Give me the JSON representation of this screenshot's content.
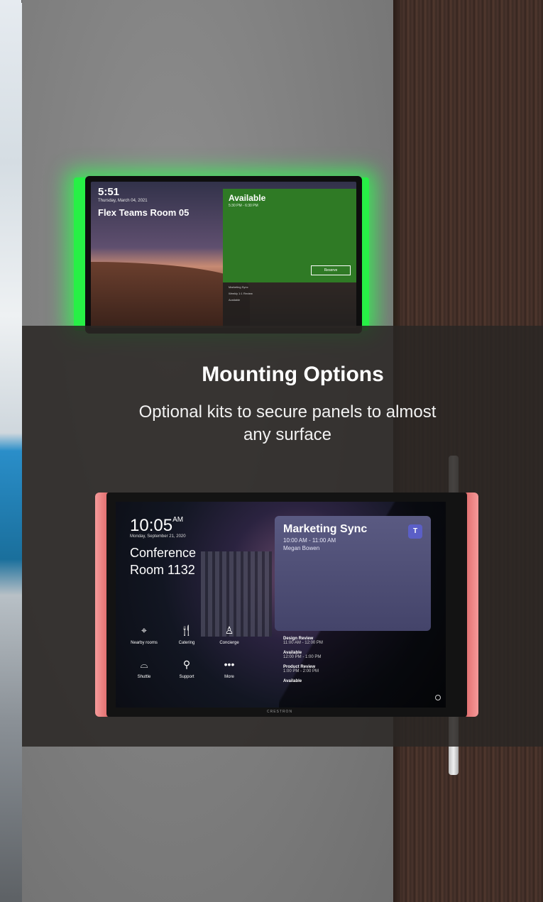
{
  "promo": {
    "heading": "Mounting Options",
    "subtext": "Optional kits to secure panels to almost any surface"
  },
  "panel_top": {
    "time": "5:51",
    "date": "Thursday, March 04, 2021",
    "room": "Flex Teams Room 05",
    "status": "Available",
    "status_time": "5:30 PM - 6:30 PM",
    "reserve_label": "Reserve",
    "schedule": [
      "Marketing Sync",
      "Weekly 1:1 Review",
      "Available"
    ]
  },
  "panel_bottom": {
    "time": "10:05",
    "ampm": "AM",
    "date": "Monday, September 21, 2020",
    "room": "Conference Room 1132",
    "meeting": {
      "title": "Marketing Sync",
      "time": "10:00 AM - 11:00 AM",
      "organizer": "Megan Bowen"
    },
    "schedule": [
      {
        "title": "Design Review",
        "time": "11:00 AM - 12:00 PM"
      },
      {
        "title": "Available",
        "time": "12:00 PM - 1:00 PM"
      },
      {
        "title": "Product Review",
        "time": "1:00 PM - 2:00 PM"
      },
      {
        "title": "Available",
        "time": ""
      }
    ],
    "services": [
      {
        "label": "Nearby rooms",
        "icon": "location-pin-icon"
      },
      {
        "label": "Catering",
        "icon": "fork-knife-icon"
      },
      {
        "label": "Concierge",
        "icon": "concierge-icon"
      },
      {
        "label": "Shuttle",
        "icon": "car-icon"
      },
      {
        "label": "Support",
        "icon": "support-icon"
      },
      {
        "label": "More",
        "icon": "more-icon"
      }
    ],
    "brand": "CRESTRON"
  },
  "colors": {
    "glow_green": "#27f046",
    "available_green": "#2f7a25",
    "meeting_card": "#55557d",
    "bezel_red": "#e37272"
  }
}
